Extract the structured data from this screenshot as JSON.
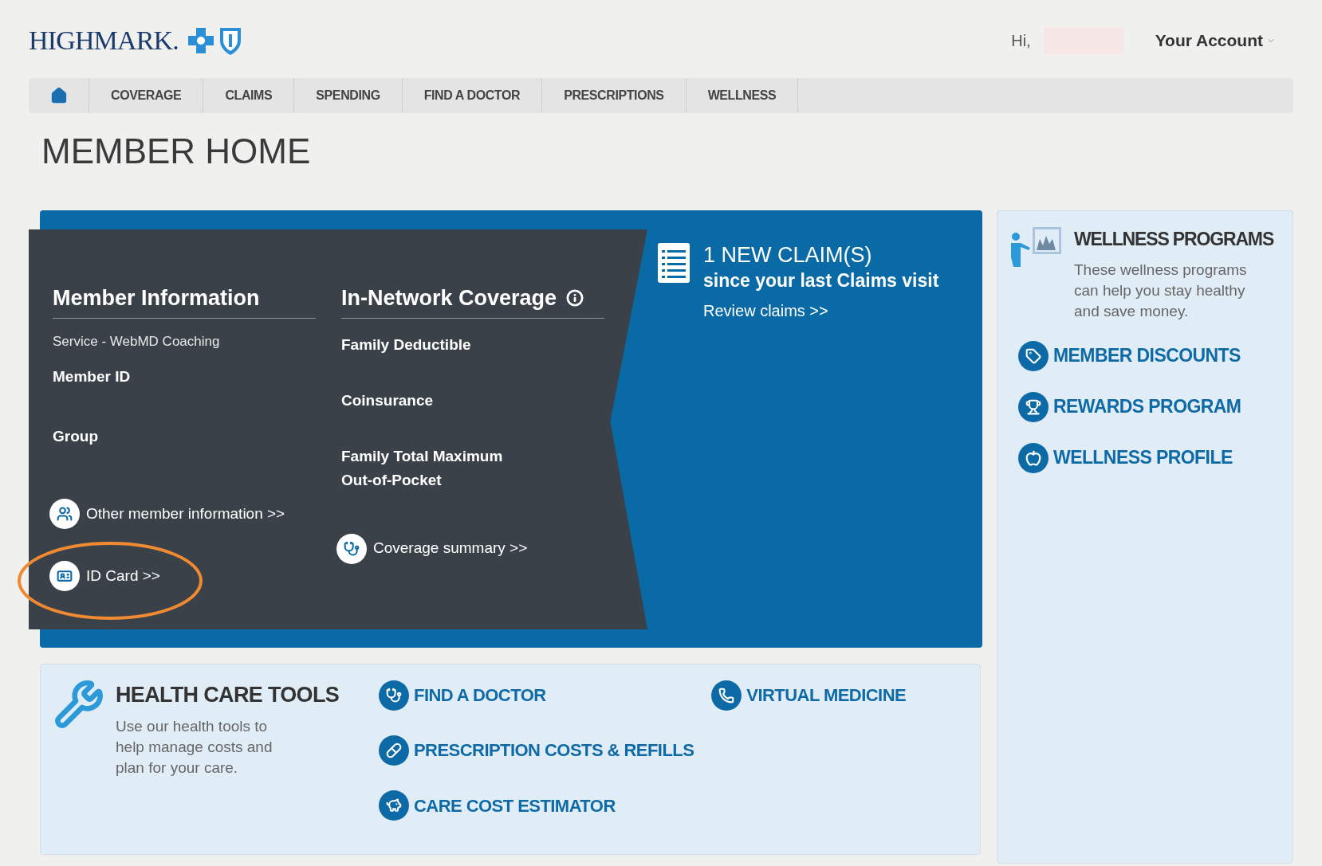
{
  "header": {
    "logo": "HIGHMARK.",
    "greeting": "Hi,",
    "account_menu": "Your Account"
  },
  "nav": {
    "items": [
      {
        "label": "COVERAGE"
      },
      {
        "label": "CLAIMS"
      },
      {
        "label": "SPENDING"
      },
      {
        "label": "FIND A DOCTOR"
      },
      {
        "label": "PRESCRIPTIONS"
      },
      {
        "label": "WELLNESS"
      }
    ]
  },
  "page_title": "MEMBER HOME",
  "member_information": {
    "title": "Member Information",
    "service": "Service - WebMD Coaching",
    "fields": [
      "Member ID",
      "Group"
    ],
    "links": [
      {
        "label": "Other member information >>",
        "kind": "people"
      },
      {
        "label": "ID Card >>",
        "kind": "card"
      }
    ]
  },
  "in_network_coverage": {
    "title": "In-Network Coverage",
    "fields": [
      "Family Deductible",
      "Coinsurance",
      "Family Total Maximum Out-of-Pocket"
    ],
    "link": {
      "label": "Coverage summary >>",
      "kind": "doctor"
    }
  },
  "claims": {
    "headline": "1 NEW CLAIM(S)",
    "subline": "since your last Claims visit",
    "link": "Review claims >>"
  },
  "wellness_programs": {
    "title": "WELLNESS PROGRAMS",
    "description": "These wellness programs can help you stay healthy and save money.",
    "links": [
      {
        "label": "MEMBER DISCOUNTS",
        "kind": "tag"
      },
      {
        "label": "REWARDS PROGRAM",
        "kind": "trophy"
      },
      {
        "label": "WELLNESS PROFILE",
        "kind": "apple"
      }
    ]
  },
  "health_care_tools": {
    "title": "HEALTH CARE TOOLS",
    "description": "Use our health tools to help manage costs and plan for your care.",
    "links": [
      {
        "label": "FIND A DOCTOR",
        "kind": "doctor"
      },
      {
        "label": "PRESCRIPTION COSTS & REFILLS",
        "kind": "pill"
      },
      {
        "label": "CARE COST ESTIMATOR",
        "kind": "piggy"
      },
      {
        "label": "VIRTUAL MEDICINE",
        "kind": "phone"
      }
    ]
  }
}
